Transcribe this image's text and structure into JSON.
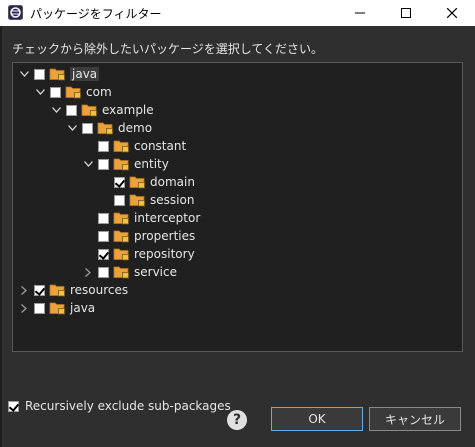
{
  "window": {
    "title": "パッケージをフィルター",
    "minimize_icon": "minimize-icon",
    "maximize_icon": "maximize-icon",
    "close_icon": "close-icon"
  },
  "instruction": "チェックから除外したいパッケージを選択してください。",
  "tree": [
    {
      "label": "java",
      "depth": 0,
      "expanded": true,
      "checked": false,
      "selected": true
    },
    {
      "label": "com",
      "depth": 1,
      "expanded": true,
      "checked": false
    },
    {
      "label": "example",
      "depth": 2,
      "expanded": true,
      "checked": false
    },
    {
      "label": "demo",
      "depth": 3,
      "expanded": true,
      "checked": false
    },
    {
      "label": "constant",
      "depth": 4,
      "expanded": null,
      "checked": false
    },
    {
      "label": "entity",
      "depth": 4,
      "expanded": true,
      "checked": false
    },
    {
      "label": "domain",
      "depth": 5,
      "expanded": null,
      "checked": true
    },
    {
      "label": "session",
      "depth": 5,
      "expanded": null,
      "checked": false
    },
    {
      "label": "interceptor",
      "depth": 4,
      "expanded": null,
      "checked": false
    },
    {
      "label": "properties",
      "depth": 4,
      "expanded": null,
      "checked": false
    },
    {
      "label": "repository",
      "depth": 4,
      "expanded": null,
      "checked": true
    },
    {
      "label": "service",
      "depth": 4,
      "expanded": false,
      "checked": false
    },
    {
      "label": "resources",
      "depth": 0,
      "expanded": false,
      "checked": true
    },
    {
      "label": "java",
      "depth": 0,
      "expanded": false,
      "checked": false
    }
  ],
  "options": {
    "recursive_label": "Recursively exclude sub-packages",
    "recursive_checked": true
  },
  "buttons": {
    "ok_label": "OK",
    "cancel_label": "キャンセル"
  },
  "colors": {
    "folder": "#e8a33c",
    "package_dot": "#f0c040"
  }
}
